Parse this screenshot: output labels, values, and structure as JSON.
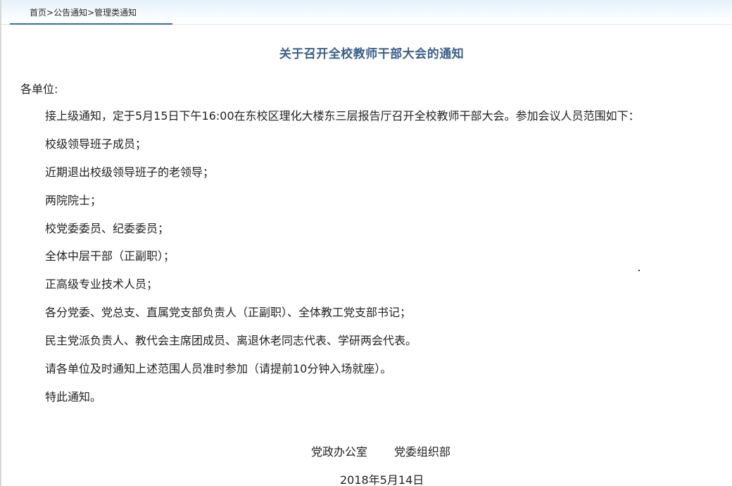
{
  "breadcrumb": {
    "home": "首页",
    "sep1": ">",
    "section": "公告通知",
    "sep2": ">",
    "category": "管理类通知"
  },
  "notice": {
    "title": "关于召开全校教师干部大会的通知",
    "salutation": "各单位:",
    "paragraphs": [
      "接上级通知，定于5月15日下午16:00在东校区理化大楼东三层报告厅召开全校教师干部大会。参加会议人员范围如下：",
      "校级领导班子成员；",
      "近期退出校级领导班子的老领导；",
      "两院院士；",
      "校党委委员、纪委委员；",
      "全体中层干部（正副职）；",
      "正高级专业技术人员；",
      "各分党委、党总支、直属党支部负责人（正副职）、全体教工党支部书记；",
      "民主党派负责人、教代会主席团成员、离退休老同志代表、学研两会代表。",
      "请各单位及时通知上述范围人员准时参加（请提前10分钟入场就座）。",
      "特此通知。"
    ],
    "signature": {
      "office1": "党政办公室",
      "office2": "党委组织部",
      "date": "2018年5月14日"
    }
  },
  "colors": {
    "title": "#3b5f8c",
    "accent": "#2f6fb5",
    "header_gradient_top": "#e6f1fa"
  }
}
